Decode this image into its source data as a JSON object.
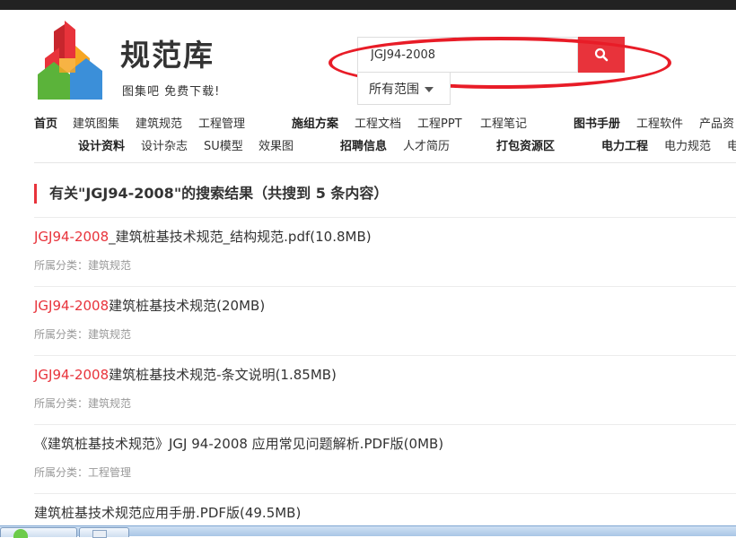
{
  "logo": {
    "name": "规范库",
    "slogan": "图集吧 免费下载!",
    "colors": {
      "red": "#e8333b",
      "orange": "#f6a623",
      "green": "#5bb33a",
      "blue": "#3b8fd9"
    }
  },
  "search": {
    "value": "JGJ94-2008",
    "scope": "所有范围",
    "button_icon": "search-icon",
    "accent": "#e8333b"
  },
  "nav": {
    "row1": [
      "首页",
      "建筑图集",
      "建筑规范",
      "工程管理",
      "施组方案",
      "工程文档",
      "工程PPT",
      "工程笔记",
      "图书手册",
      "工程软件",
      "产品资"
    ],
    "row2": [
      "设计资料",
      "设计杂志",
      "SU模型",
      "效果图",
      "招聘信息",
      "人才简历",
      "打包资源区",
      "电力工程",
      "电力规范",
      "电"
    ]
  },
  "results": {
    "heading": "有关\"JGJ94-2008\"的搜索结果（共搜到 5 条内容）",
    "items": [
      {
        "highlight": "JGJ94-2008",
        "title": "_建筑桩基技术规范_结构规范.pdf(10.8MB)",
        "category": "所属分类：建筑规范"
      },
      {
        "highlight": "JGJ94-2008",
        "title": "建筑桩基技术规范(20MB)",
        "category": "所属分类：建筑规范"
      },
      {
        "highlight": "JGJ94-2008",
        "title": "建筑桩基技术规范-条文说明(1.85MB)",
        "category": "所属分类：建筑规范"
      },
      {
        "highlight": "",
        "title": "《建筑桩基技术规范》JGJ 94-2008 应用常见问题解析.PDF版(0MB)",
        "category": "所属分类：工程管理"
      },
      {
        "highlight": "",
        "title": "建筑桩基技术规范应用手册.PDF版(49.5MB)",
        "category": ""
      }
    ]
  }
}
